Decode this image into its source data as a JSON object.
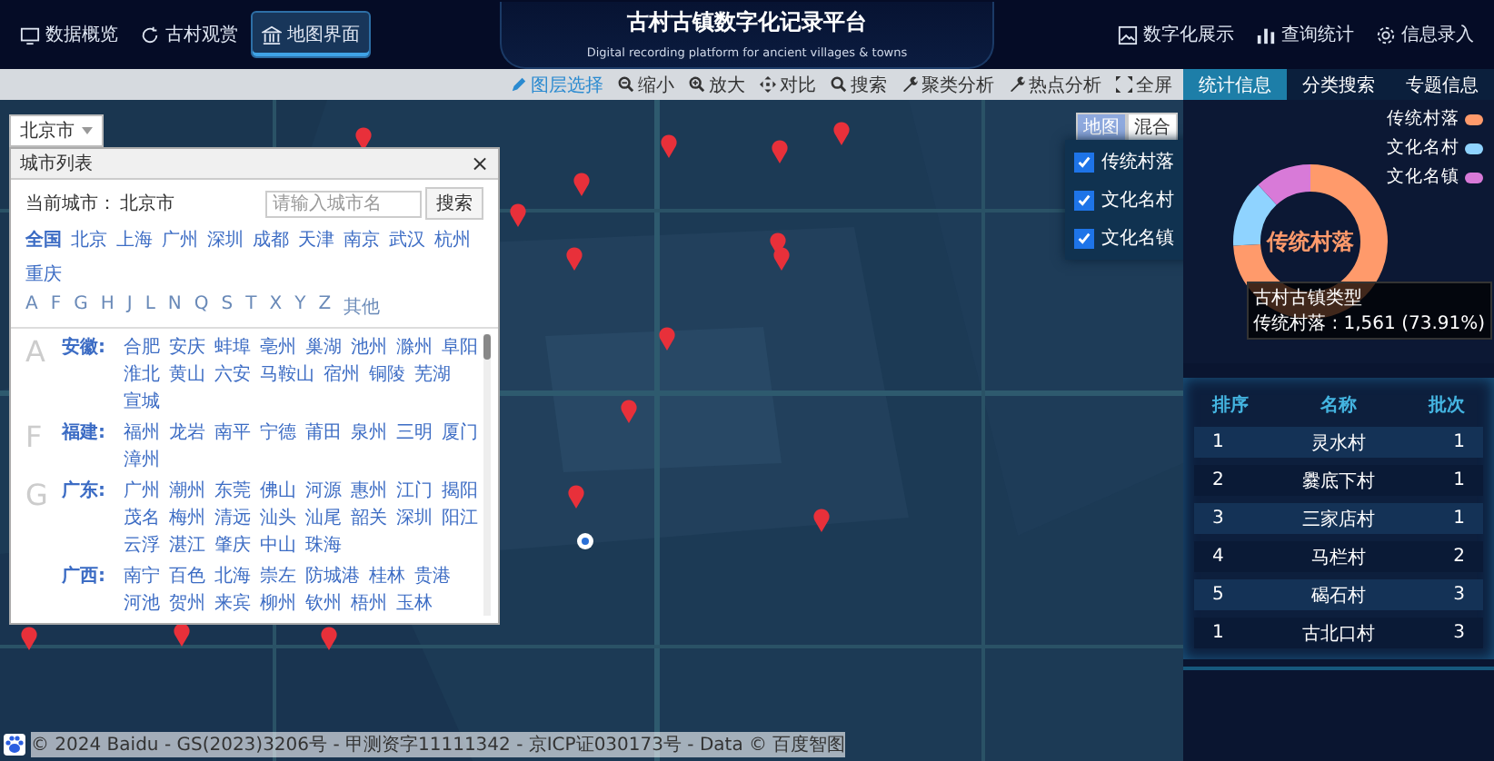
{
  "nav_left": [
    {
      "label": "数据概览",
      "selected": false
    },
    {
      "label": "古村观赏",
      "selected": false
    },
    {
      "label": "地图界面",
      "selected": true
    }
  ],
  "title": "古村古镇数字化记录平台",
  "subtitle": "Digital recording platform for ancient villages & towns",
  "nav_right": [
    {
      "label": "数字化展示"
    },
    {
      "label": "查询统计"
    },
    {
      "label": "信息录入"
    }
  ],
  "toolbar": [
    {
      "label": "图层选择",
      "selected": true
    },
    {
      "label": "缩小",
      "selected": false
    },
    {
      "label": "放大",
      "selected": false
    },
    {
      "label": "对比",
      "selected": false
    },
    {
      "label": "搜索",
      "selected": false
    },
    {
      "label": "聚类分析",
      "selected": false
    },
    {
      "label": "热点分析",
      "selected": false
    },
    {
      "label": "全屏",
      "selected": false
    }
  ],
  "city_select": {
    "value": "北京市",
    "panel_title": "城市列表",
    "close": "×",
    "current_label": "当前城市：",
    "current_city": "北京市",
    "placeholder": "请输入城市名",
    "search_button": "搜索",
    "hot_cities": [
      "全国",
      "北京",
      "上海",
      "广州",
      "深圳",
      "成都",
      "天津",
      "南京",
      "武汉",
      "杭州",
      "重庆"
    ],
    "letters": [
      "A",
      "F",
      "G",
      "H",
      "J",
      "L",
      "N",
      "Q",
      "S",
      "T",
      "X",
      "Y",
      "Z",
      "其他"
    ],
    "groups": [
      {
        "letter": "A",
        "provinces": [
          {
            "name": "安徽:",
            "cities": [
              "合肥",
              "安庆",
              "蚌埠",
              "亳州",
              "巢湖",
              "池州",
              "滁州",
              "阜阳",
              "淮北",
              "黄山",
              "六安",
              "马鞍山",
              "宿州",
              "铜陵",
              "芜湖",
              "宣城"
            ]
          }
        ]
      },
      {
        "letter": "F",
        "provinces": [
          {
            "name": "福建:",
            "cities": [
              "福州",
              "龙岩",
              "南平",
              "宁德",
              "莆田",
              "泉州",
              "三明",
              "厦门",
              "漳州"
            ]
          }
        ]
      },
      {
        "letter": "G",
        "provinces": [
          {
            "name": "广东:",
            "cities": [
              "广州",
              "潮州",
              "东莞",
              "佛山",
              "河源",
              "惠州",
              "江门",
              "揭阳",
              "茂名",
              "梅州",
              "清远",
              "汕头",
              "汕尾",
              "韶关",
              "深圳",
              "阳江",
              "云浮",
              "湛江",
              "肇庆",
              "中山",
              "珠海"
            ]
          },
          {
            "name": "广西:",
            "cities": [
              "南宁",
              "百色",
              "北海",
              "崇左",
              "防城港",
              "桂林",
              "贵港",
              "河池",
              "贺州",
              "来宾",
              "柳州",
              "钦州",
              "梧州",
              "玉林"
            ]
          }
        ]
      }
    ]
  },
  "map_type": [
    {
      "label": "地图",
      "selected": true
    },
    {
      "label": "混合",
      "selected": false
    }
  ],
  "layers": [
    {
      "label": "传统村落",
      "checked": true
    },
    {
      "label": "文化名村",
      "checked": true
    },
    {
      "label": "文化名镇",
      "checked": true
    }
  ],
  "copyright": "© 2024 Baidu - GS(2023)3206号 - 甲测资字11111342 - 京ICP证030173号 - Data © 百度智图",
  "panel_tabs": [
    {
      "label": "统计信息",
      "selected": true
    },
    {
      "label": "分类搜索",
      "selected": false
    },
    {
      "label": "专题信息",
      "selected": false
    }
  ],
  "donut": {
    "center_label": "传统村落",
    "legend": [
      {
        "label": "传统村落",
        "color": "#ff9a6b"
      },
      {
        "label": "文化名村",
        "color": "#8fd3ff"
      },
      {
        "label": "文化名镇",
        "color": "#d87ad8"
      }
    ],
    "tooltip_title": "古村古镇类型",
    "tooltip_text": "传统村落 : 1,561 (73.91%)"
  },
  "ranking": {
    "columns": [
      "排序",
      "名称",
      "批次"
    ],
    "rows": [
      [
        "1",
        "灵水村",
        "1"
      ],
      [
        "2",
        "爨底下村",
        "1"
      ],
      [
        "3",
        "三家店村",
        "1"
      ],
      [
        "4",
        "马栏村",
        "2"
      ],
      [
        "5",
        "碣石村",
        "3"
      ],
      [
        "1",
        "古北口村",
        "3"
      ]
    ]
  }
}
